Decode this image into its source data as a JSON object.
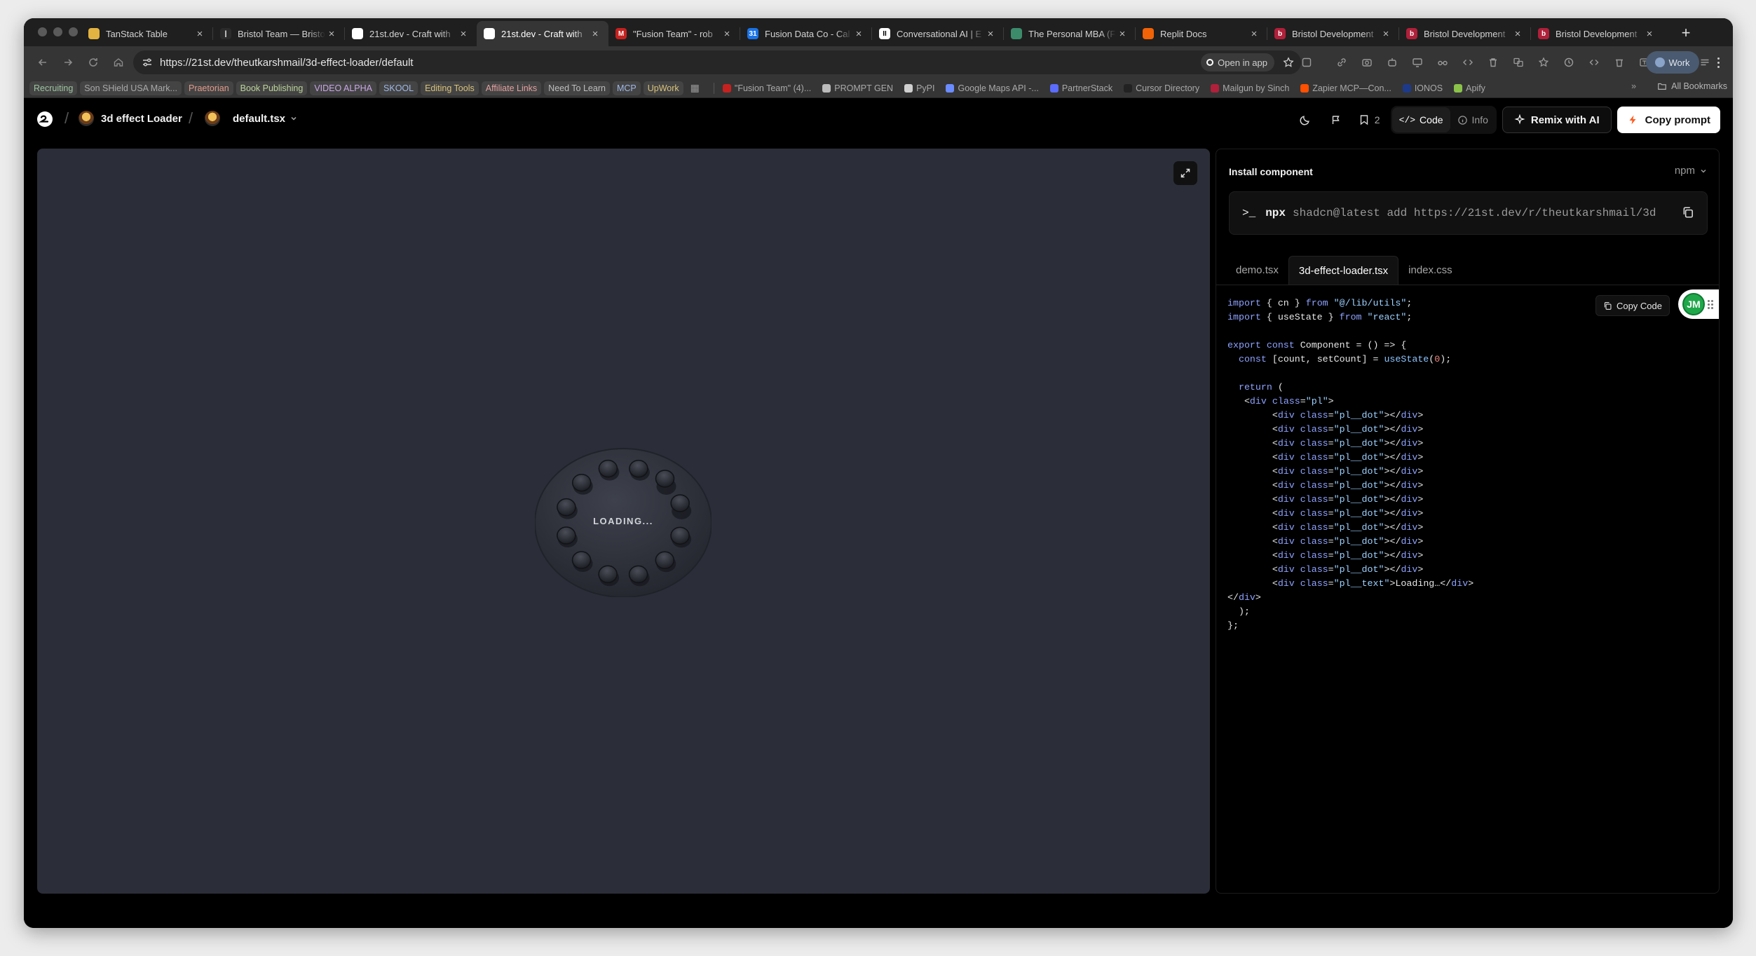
{
  "browser": {
    "tabs": [
      {
        "title": "TanStack Table",
        "color": "#e3b341",
        "glyph": ""
      },
      {
        "title": "Bristol Team — Bristol",
        "color": "#2b2b2b",
        "glyph": "|"
      },
      {
        "title": "21st.dev - Craft with",
        "color": "#ffffff",
        "glyph": ""
      },
      {
        "title": "21st.dev - Craft with",
        "color": "#ffffff",
        "glyph": ""
      },
      {
        "title": "\"Fusion Team\" - rob",
        "color": "#c5221f",
        "glyph": "M"
      },
      {
        "title": "Fusion Data Co - Cal",
        "color": "#1a73e8",
        "glyph": "31"
      },
      {
        "title": "Conversational AI | E",
        "color": "#ffffff",
        "glyph": "II"
      },
      {
        "title": "The Personal MBA (F",
        "color": "#3c8c6c",
        "glyph": ""
      },
      {
        "title": "Replit Docs",
        "color": "#f26207",
        "glyph": ""
      },
      {
        "title": "Bristol Development",
        "color": "#b0203a",
        "glyph": "b"
      },
      {
        "title": "Bristol Development",
        "color": "#b0203a",
        "glyph": "b"
      },
      {
        "title": "Bristol Development",
        "color": "#b0203a",
        "glyph": "b"
      }
    ],
    "active_tab": 3,
    "url": "https://21st.dev/theutkarshmail/3d-effect-loader/default",
    "open_in_app": "Open in app",
    "profile": "Work",
    "bookmarks": [
      {
        "label": "Recruiting",
        "chip": true,
        "color": "#9ec5a0"
      },
      {
        "label": "Son SHield USA Mark...",
        "chip": true,
        "color": "#a9a9a9"
      },
      {
        "label": "Praetorian",
        "chip": true,
        "color": "#e39b8b"
      },
      {
        "label": "Book Publishing",
        "chip": true,
        "color": "#bcd49a"
      },
      {
        "label": "VIDEO ALPHA",
        "chip": true,
        "color": "#c8a6e6"
      },
      {
        "label": "SKOOL",
        "chip": true,
        "color": "#9fb8e8"
      },
      {
        "label": "Editing Tools",
        "chip": true,
        "color": "#d9c27a"
      },
      {
        "label": "Affiliate Links",
        "chip": true,
        "color": "#e3a0a0"
      },
      {
        "label": "Need To Learn",
        "chip": true,
        "color": "#bdbdbd"
      },
      {
        "label": "MCP",
        "chip": true,
        "color": "#9fb8e8"
      },
      {
        "label": "UpWork",
        "chip": true,
        "color": "#d9c27a"
      },
      {
        "label": "\"Fusion Team\" (4)...",
        "chip": false,
        "color": "#c5221f"
      },
      {
        "label": "PROMPT GEN",
        "chip": false,
        "color": "#bbbbbb"
      },
      {
        "label": "PyPI",
        "chip": false,
        "color": "#cfcfcf"
      },
      {
        "label": "Google Maps API -...",
        "chip": false,
        "color": "#6b8cff"
      },
      {
        "label": "PartnerStack",
        "chip": false,
        "color": "#5b6cff"
      },
      {
        "label": "Cursor Directory",
        "chip": false,
        "color": "#222222"
      },
      {
        "label": "Mailgun by Sinch",
        "chip": false,
        "color": "#b0203a"
      },
      {
        "label": "Zapier MCP—Con...",
        "chip": false,
        "color": "#ff4f00"
      },
      {
        "label": "IONOS",
        "chip": false,
        "color": "#1d3a8a"
      },
      {
        "label": "Apify",
        "chip": false,
        "color": "#8bc34a"
      }
    ],
    "all_bookmarks": "All Bookmarks"
  },
  "header": {
    "component_name": "3d effect Loader",
    "file_name": "default.tsx",
    "bookmark_count": "2",
    "code_label": "Code",
    "info_label": "Info",
    "remix_label": "Remix with AI",
    "copy_prompt_label": "Copy prompt"
  },
  "preview": {
    "loader_text": "LOADING...",
    "dot_count": 12
  },
  "panel": {
    "title": "Install component",
    "package_manager": "npm",
    "install_prompt": ">_",
    "install_npx": "npx",
    "install_cmd": "shadcn@latest add https://21st.dev/r/theutkarshmail/3d-effect-loader",
    "file_tabs": [
      "demo.tsx",
      "3d-effect-loader.tsx",
      "index.css"
    ],
    "selected_file": 1,
    "copy_code_label": "Copy Code",
    "user_initials": "JM",
    "user_color": "#1fa84a",
    "code_lines": [
      [
        [
          "k",
          "import"
        ],
        [
          "t",
          " { cn } "
        ],
        [
          "k",
          "from"
        ],
        [
          "t",
          " "
        ],
        [
          "s",
          "\"@/lib/utils\""
        ],
        [
          "t",
          ";"
        ]
      ],
      [
        [
          "k",
          "import"
        ],
        [
          "t",
          " { useState } "
        ],
        [
          "k",
          "from"
        ],
        [
          "t",
          " "
        ],
        [
          "s",
          "\"react\""
        ],
        [
          "t",
          ";"
        ]
      ],
      [
        [
          "t",
          ""
        ]
      ],
      [
        [
          "k",
          "export const"
        ],
        [
          "t",
          " Component = () => {"
        ]
      ],
      [
        [
          "t",
          "  "
        ],
        [
          "k",
          "const"
        ],
        [
          "t",
          " [count, setCount] = "
        ],
        [
          "f",
          "useState"
        ],
        [
          "t",
          "("
        ],
        [
          "n",
          "0"
        ],
        [
          "t",
          ");"
        ]
      ],
      [
        [
          "t",
          ""
        ]
      ],
      [
        [
          "t",
          "  "
        ],
        [
          "k",
          "return"
        ],
        [
          "t",
          " ("
        ]
      ],
      [
        [
          "t",
          "   <"
        ],
        [
          "k",
          "div"
        ],
        [
          "t",
          " "
        ],
        [
          "k",
          "class"
        ],
        [
          "t",
          "="
        ],
        [
          "s",
          "\"pl\""
        ],
        [
          "t",
          ">"
        ]
      ],
      [
        [
          "t",
          "        <"
        ],
        [
          "k",
          "div"
        ],
        [
          "t",
          " "
        ],
        [
          "k",
          "class"
        ],
        [
          "t",
          "="
        ],
        [
          "s",
          "\"pl__dot\""
        ],
        [
          "t",
          "></"
        ],
        [
          "k",
          "div"
        ],
        [
          "t",
          ">"
        ]
      ],
      [
        [
          "t",
          "        <"
        ],
        [
          "k",
          "div"
        ],
        [
          "t",
          " "
        ],
        [
          "k",
          "class"
        ],
        [
          "t",
          "="
        ],
        [
          "s",
          "\"pl__dot\""
        ],
        [
          "t",
          "></"
        ],
        [
          "k",
          "div"
        ],
        [
          "t",
          ">"
        ]
      ],
      [
        [
          "t",
          "        <"
        ],
        [
          "k",
          "div"
        ],
        [
          "t",
          " "
        ],
        [
          "k",
          "class"
        ],
        [
          "t",
          "="
        ],
        [
          "s",
          "\"pl__dot\""
        ],
        [
          "t",
          "></"
        ],
        [
          "k",
          "div"
        ],
        [
          "t",
          ">"
        ]
      ],
      [
        [
          "t",
          "        <"
        ],
        [
          "k",
          "div"
        ],
        [
          "t",
          " "
        ],
        [
          "k",
          "class"
        ],
        [
          "t",
          "="
        ],
        [
          "s",
          "\"pl__dot\""
        ],
        [
          "t",
          "></"
        ],
        [
          "k",
          "div"
        ],
        [
          "t",
          ">"
        ]
      ],
      [
        [
          "t",
          "        <"
        ],
        [
          "k",
          "div"
        ],
        [
          "t",
          " "
        ],
        [
          "k",
          "class"
        ],
        [
          "t",
          "="
        ],
        [
          "s",
          "\"pl__dot\""
        ],
        [
          "t",
          "></"
        ],
        [
          "k",
          "div"
        ],
        [
          "t",
          ">"
        ]
      ],
      [
        [
          "t",
          "        <"
        ],
        [
          "k",
          "div"
        ],
        [
          "t",
          " "
        ],
        [
          "k",
          "class"
        ],
        [
          "t",
          "="
        ],
        [
          "s",
          "\"pl__dot\""
        ],
        [
          "t",
          "></"
        ],
        [
          "k",
          "div"
        ],
        [
          "t",
          ">"
        ]
      ],
      [
        [
          "t",
          "        <"
        ],
        [
          "k",
          "div"
        ],
        [
          "t",
          " "
        ],
        [
          "k",
          "class"
        ],
        [
          "t",
          "="
        ],
        [
          "s",
          "\"pl__dot\""
        ],
        [
          "t",
          "></"
        ],
        [
          "k",
          "div"
        ],
        [
          "t",
          ">"
        ]
      ],
      [
        [
          "t",
          "        <"
        ],
        [
          "k",
          "div"
        ],
        [
          "t",
          " "
        ],
        [
          "k",
          "class"
        ],
        [
          "t",
          "="
        ],
        [
          "s",
          "\"pl__dot\""
        ],
        [
          "t",
          "></"
        ],
        [
          "k",
          "div"
        ],
        [
          "t",
          ">"
        ]
      ],
      [
        [
          "t",
          "        <"
        ],
        [
          "k",
          "div"
        ],
        [
          "t",
          " "
        ],
        [
          "k",
          "class"
        ],
        [
          "t",
          "="
        ],
        [
          "s",
          "\"pl__dot\""
        ],
        [
          "t",
          "></"
        ],
        [
          "k",
          "div"
        ],
        [
          "t",
          ">"
        ]
      ],
      [
        [
          "t",
          "        <"
        ],
        [
          "k",
          "div"
        ],
        [
          "t",
          " "
        ],
        [
          "k",
          "class"
        ],
        [
          "t",
          "="
        ],
        [
          "s",
          "\"pl__dot\""
        ],
        [
          "t",
          "></"
        ],
        [
          "k",
          "div"
        ],
        [
          "t",
          ">"
        ]
      ],
      [
        [
          "t",
          "        <"
        ],
        [
          "k",
          "div"
        ],
        [
          "t",
          " "
        ],
        [
          "k",
          "class"
        ],
        [
          "t",
          "="
        ],
        [
          "s",
          "\"pl__dot\""
        ],
        [
          "t",
          "></"
        ],
        [
          "k",
          "div"
        ],
        [
          "t",
          ">"
        ]
      ],
      [
        [
          "t",
          "        <"
        ],
        [
          "k",
          "div"
        ],
        [
          "t",
          " "
        ],
        [
          "k",
          "class"
        ],
        [
          "t",
          "="
        ],
        [
          "s",
          "\"pl__dot\""
        ],
        [
          "t",
          "></"
        ],
        [
          "k",
          "div"
        ],
        [
          "t",
          ">"
        ]
      ],
      [
        [
          "t",
          "        <"
        ],
        [
          "k",
          "div"
        ],
        [
          "t",
          " "
        ],
        [
          "k",
          "class"
        ],
        [
          "t",
          "="
        ],
        [
          "s",
          "\"pl__text\""
        ],
        [
          "t",
          ">Loading…</"
        ],
        [
          "k",
          "div"
        ],
        [
          "t",
          ">"
        ]
      ],
      [
        [
          "t",
          "</"
        ],
        [
          "k",
          "div"
        ],
        [
          "t",
          ">"
        ]
      ],
      [
        [
          "t",
          "  );"
        ]
      ],
      [
        [
          "t",
          "};"
        ]
      ]
    ]
  }
}
